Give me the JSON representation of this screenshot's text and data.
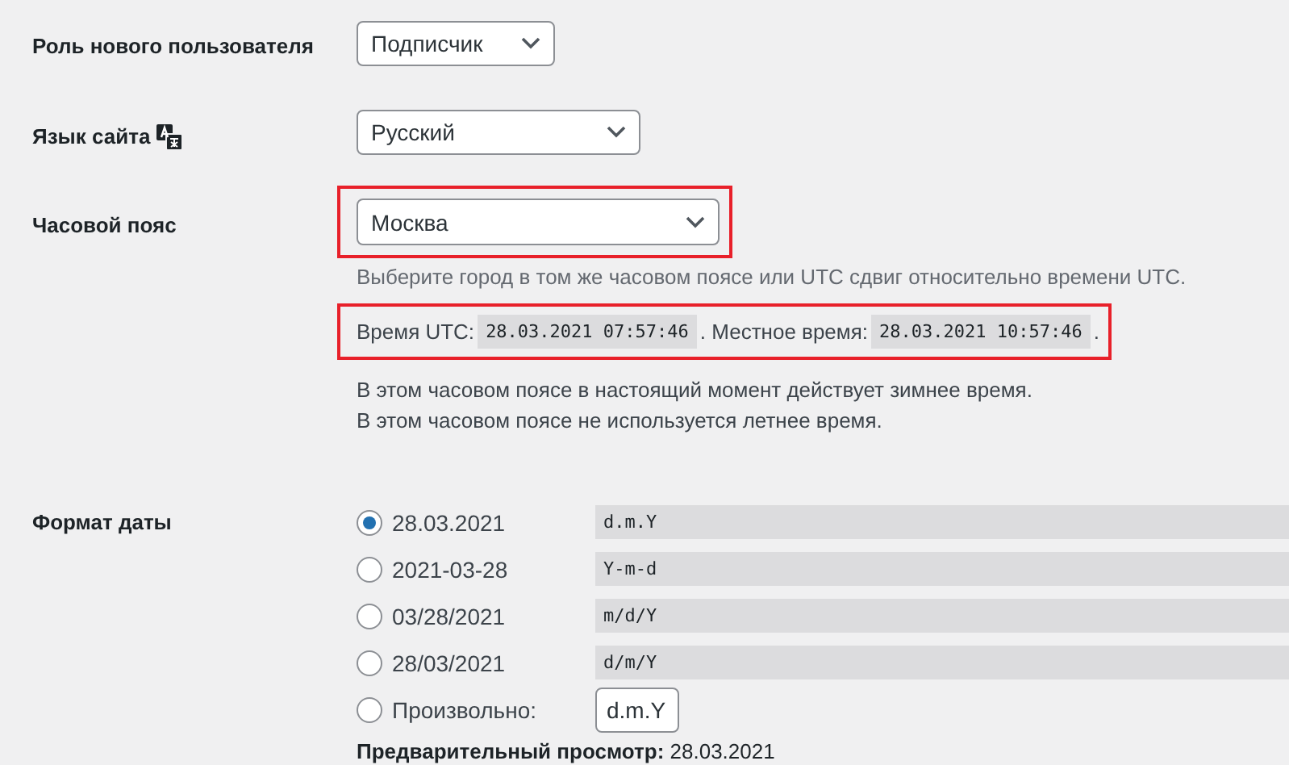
{
  "role": {
    "label": "Роль нового пользователя",
    "value": "Подписчик"
  },
  "language": {
    "label": "Язык сайта",
    "value": "Русский"
  },
  "timezone": {
    "label": "Часовой пояс",
    "value": "Москва",
    "highlighted": true,
    "description": "Выберите город в том же часовом поясе или UTC сдвиг относительно времени UTC.",
    "time_row": {
      "highlighted": true,
      "utc_label": "Время UTC:",
      "utc_value": "28.03.2021 07:57:46",
      "local_label": ". Местное время:",
      "local_value": "28.03.2021 10:57:46",
      "end": "."
    },
    "notes": [
      "В этом часовом поясе в настоящий момент действует зимнее время.",
      "В этом часовом поясе не используется летнее время."
    ]
  },
  "date_format": {
    "label": "Формат даты",
    "options": [
      {
        "kind": "preset",
        "label": "28.03.2021",
        "code": "d.m.Y",
        "selected": true
      },
      {
        "kind": "preset",
        "label": "2021-03-28",
        "code": "Y-m-d",
        "selected": false
      },
      {
        "kind": "preset",
        "label": "03/28/2021",
        "code": "m/d/Y",
        "selected": false
      },
      {
        "kind": "preset",
        "label": "28/03/2021",
        "code": "d/m/Y",
        "selected": false
      },
      {
        "kind": "custom",
        "label": "Произвольно:",
        "value": "d.m.Y",
        "selected": false
      }
    ],
    "preview": "**Предварительный просмотр:** 28.03.2021"
  }
}
